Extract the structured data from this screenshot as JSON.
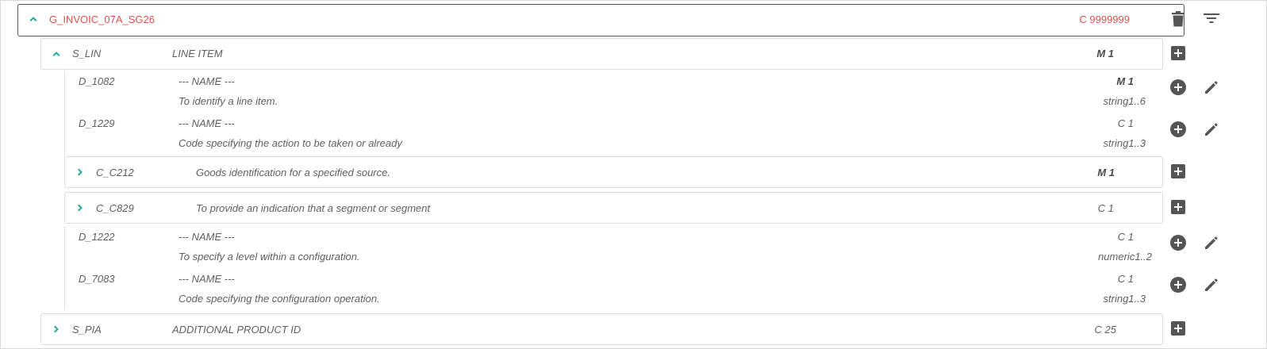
{
  "colors": {
    "accent": "#26a69a",
    "root_text": "#e05050",
    "icon": "#555555"
  },
  "root": {
    "name": "G_INVOIC_07A_SG26",
    "cardinality": "C 9999999",
    "icons": [
      "chevron-up-icon",
      "delete-icon",
      "filter-icon"
    ]
  },
  "segment_lin": {
    "id": "S_LIN",
    "label": "LINE ITEM",
    "cardinality": "M 1"
  },
  "fields": [
    {
      "id": "D_1082",
      "name": "--- NAME ---",
      "description": "To identify a line item.",
      "cardinality": "M 1",
      "type": "string1..6"
    },
    {
      "id": "D_1229",
      "name": "--- NAME ---",
      "description": "Code specifying the action to be taken or already",
      "cardinality": "C 1",
      "type": "string1..3"
    },
    {
      "id": "D_1222",
      "name": "--- NAME ---",
      "description": "To specify a level within a configuration.",
      "cardinality": "C 1",
      "type": "numeric1..2"
    },
    {
      "id": "D_7083",
      "name": "--- NAME ---",
      "description": "Code specifying the configuration operation.",
      "cardinality": "C 1",
      "type": "string1..3"
    }
  ],
  "composites": [
    {
      "id": "C_C212",
      "description": "Goods identification for a specified source.",
      "cardinality": "M 1"
    },
    {
      "id": "C_C829",
      "description": "To provide an indication that a segment or segment",
      "cardinality": "C 1"
    }
  ],
  "segment_pia": {
    "id": "S_PIA",
    "label": "ADDITIONAL PRODUCT ID",
    "cardinality": "C 25"
  }
}
